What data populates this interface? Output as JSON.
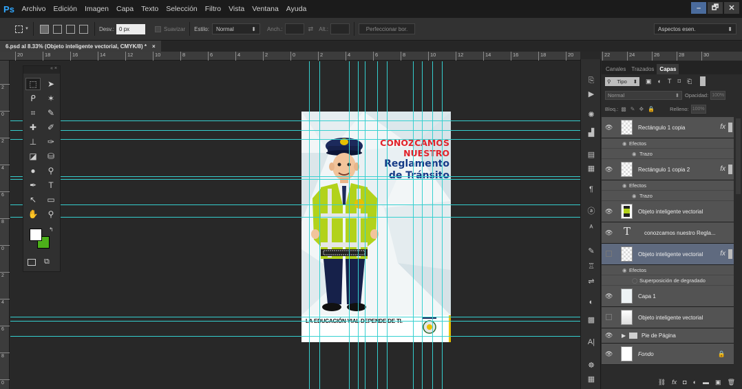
{
  "app": {
    "logo": "Ps",
    "menu": [
      "Archivo",
      "Edición",
      "Imagen",
      "Capa",
      "Texto",
      "Selección",
      "Filtro",
      "Vista",
      "Ventana",
      "Ayuda"
    ],
    "window_buttons": [
      "–",
      "🗗",
      "✕"
    ]
  },
  "options": {
    "desv_label": "Desv.:",
    "desv_value": "0 px",
    "suavizar_label": "Suavizar",
    "estilo_label": "Estilo:",
    "estilo_value": "Normal",
    "anch_label": "Anch.:",
    "alt_label": "Alt.:",
    "refine_button": "Perfeccionar bor.",
    "workspace": "Aspectos esen."
  },
  "document": {
    "tab_title": "6.psd al 8.33% (Objeto inteligente vectorial, CMYK/8) *",
    "tab_close": "×"
  },
  "rulers": {
    "h_ticks": [
      "20",
      "18",
      "16",
      "14",
      "12",
      "10",
      "8",
      "6",
      "4",
      "2",
      "0",
      "2",
      "4",
      "6",
      "8",
      "10",
      "12",
      "14",
      "16",
      "18",
      "20"
    ],
    "h_ticks_right": [
      "22",
      "24",
      "26",
      "28",
      "30"
    ],
    "v_ticks": [
      "2",
      "0",
      "2",
      "4",
      "6",
      "8",
      "0",
      "2",
      "4",
      "6",
      "8",
      "0"
    ]
  },
  "poster": {
    "title_line1": "CONOZCAMOS",
    "title_line2": "NUESTRO",
    "title_line3": "Reglamento",
    "title_line4": "de Tránsito",
    "footer_text": "LA EDUCACIÓN VIAL DEPENDE DE TI."
  },
  "layers_panel": {
    "tabs": [
      "Canales",
      "Trazados",
      "Capas"
    ],
    "filter_label": "Tipo",
    "blend_mode": "Normal",
    "opacity_label": "Opacidad:",
    "opacity_value": "100%",
    "lock_label": "Bloq.:",
    "fill_label": "Relleno:",
    "fill_value": "100%",
    "layers": [
      {
        "name": "Rectángulo 1 copia",
        "fx": "fx",
        "effects_label": "Efectos",
        "effect": "Trazo"
      },
      {
        "name": "Rectángulo 1 copia 2",
        "fx": "fx",
        "effects_label": "Efectos",
        "effect": "Trazo"
      },
      {
        "name": "Objeto inteligente vectorial"
      },
      {
        "name": "conozcamos nuestro Regla..."
      },
      {
        "name": "Objeto inteligente vectorial",
        "fx": "fx",
        "effects_label": "Efectos",
        "effect": "Superposición de degradado"
      },
      {
        "name": "Capa 1"
      },
      {
        "name": "Objeto inteligente vectorial"
      },
      {
        "name": "Pie de Página"
      },
      {
        "name": "Fondo"
      }
    ]
  },
  "colors": {
    "foreground": "#ffffff",
    "background": "#4cb01a",
    "guide": "#35d0d0"
  }
}
